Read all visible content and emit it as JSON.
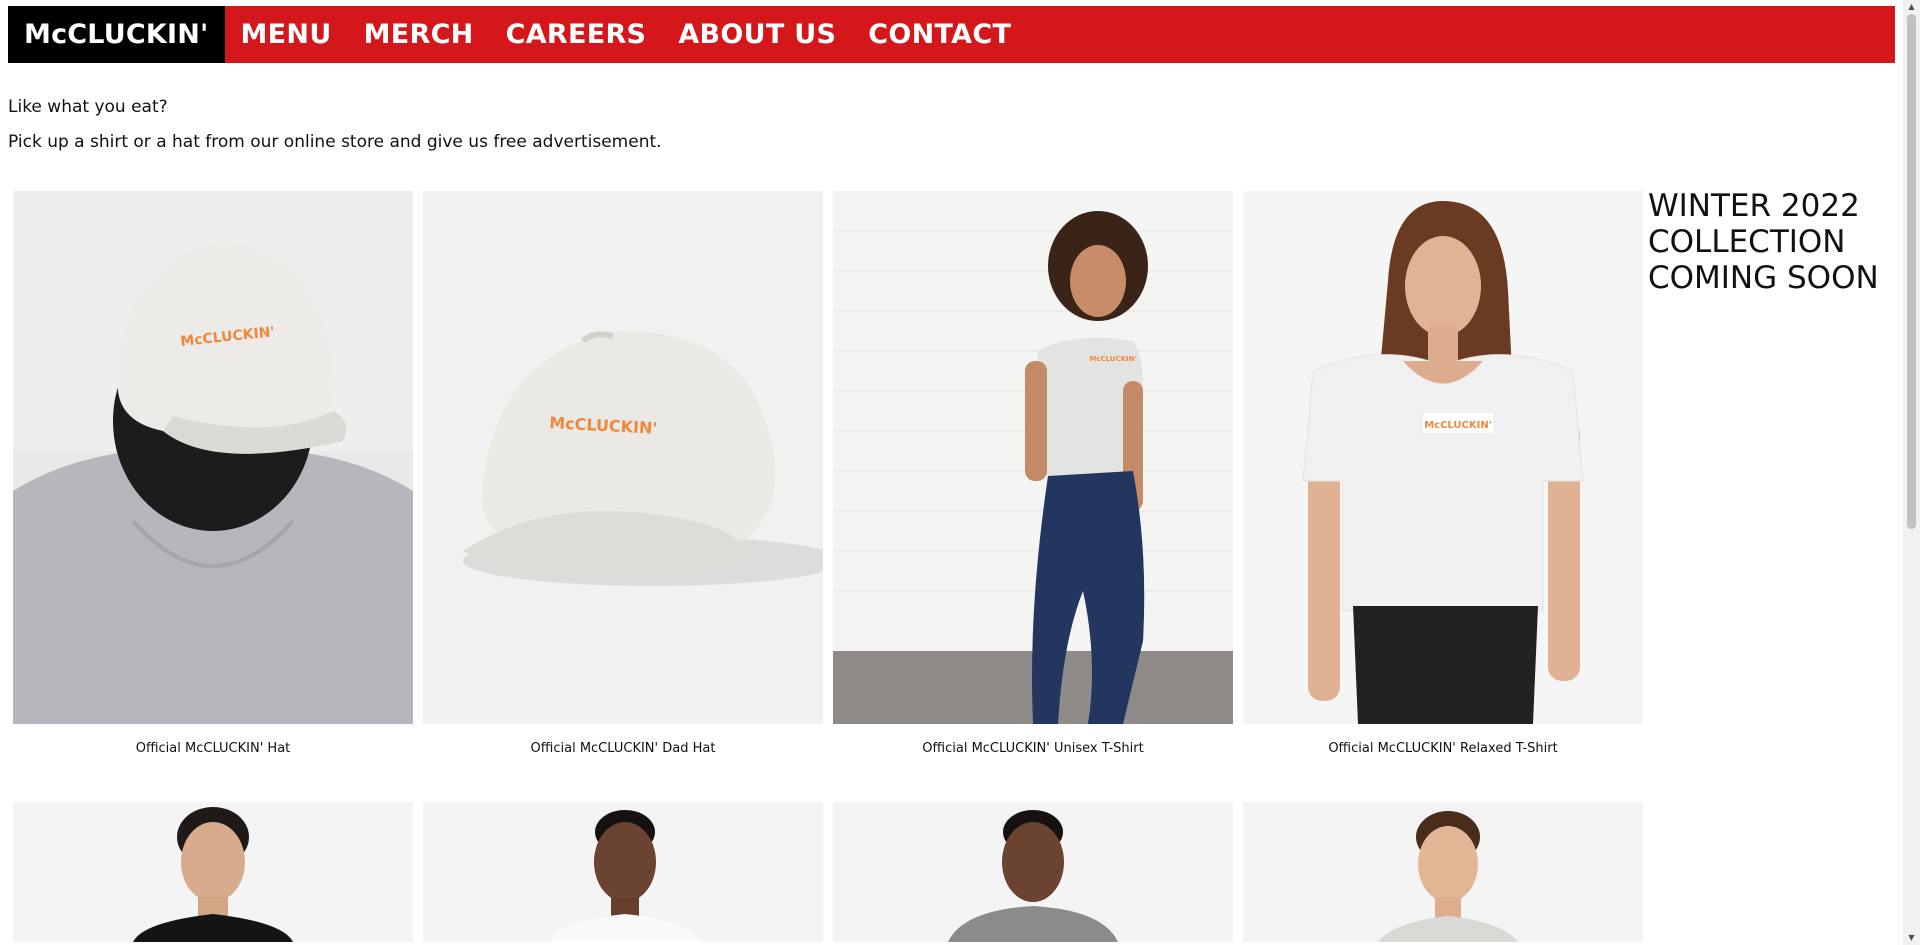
{
  "nav": {
    "brand": "McCLUCKIN'",
    "items": [
      "MENU",
      "MERCH",
      "CAREERS",
      "ABOUT US",
      "CONTACT"
    ]
  },
  "intro": {
    "line1": "Like what you eat?",
    "line2": "Pick up a shirt or a hat from our online store and give us free advertisement."
  },
  "products": [
    {
      "name": "Official McCLUCKIN' Hat"
    },
    {
      "name": "Official McCLUCKIN' Dad Hat"
    },
    {
      "name": "Official McCLUCKIN' Unisex T-Shirt"
    },
    {
      "name": "Official McCLUCKIN' Relaxed T-Shirt"
    }
  ],
  "product_logo_text": "McCLUCKIN'",
  "promo": {
    "line1": "WINTER 2022",
    "line2": "COLLECTION",
    "line3": "COMING SOON"
  },
  "colors": {
    "nav_bg": "#d3171b",
    "brand_bg": "#000000",
    "logo_orange": "#f0873c"
  }
}
